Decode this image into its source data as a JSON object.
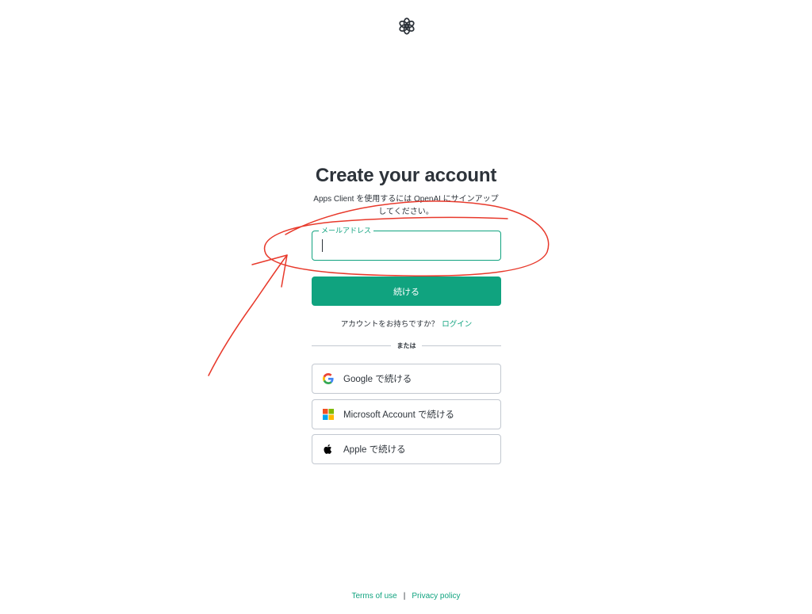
{
  "header": {
    "logo_icon": "openai-logo-icon"
  },
  "main": {
    "title": "Create your account",
    "subtitle_line1": "Apps Client を使用するには OpenAI にサインアップ",
    "subtitle_line2": "してください。",
    "email": {
      "label": "メールアドレス",
      "value": "",
      "placeholder": ""
    },
    "continue_label": "続ける",
    "login_prompt": "アカウントをお持ちですか？",
    "login_link": "ログイン",
    "divider_text": "または",
    "social": [
      {
        "icon": "google-icon",
        "label": "Google で続ける"
      },
      {
        "icon": "microsoft-icon",
        "label": "Microsoft Account で続ける"
      },
      {
        "icon": "apple-icon",
        "label": "Apple で続ける"
      }
    ]
  },
  "footer": {
    "terms": "Terms of use",
    "separator": "|",
    "privacy": "Privacy policy"
  },
  "colors": {
    "accent": "#10a37f",
    "text": "#2d333a",
    "border": "#c2c8d0",
    "annotation": "#e8392b"
  }
}
